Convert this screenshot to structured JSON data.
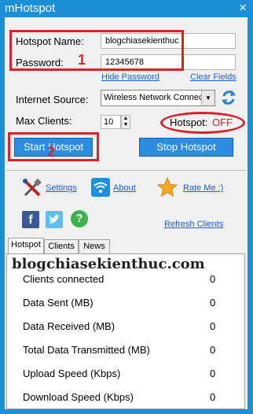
{
  "window": {
    "title": "mHotspot",
    "close_symbol": "×"
  },
  "form": {
    "hotspot_name_label": "Hotspot Name:",
    "hotspot_name_value": "blogchiasekienthuc",
    "password_label": "Password:",
    "password_value": "12345678",
    "hide_password_link": "Hide Password",
    "clear_fields_link": "Clear Fields",
    "internet_source_label": "Internet Source:",
    "internet_source_value": "Wireless Network Connec",
    "max_clients_label": "Max Clients:",
    "max_clients_value": "10",
    "hotspot_status_label": "Hotspot:",
    "hotspot_status_value": "OFF"
  },
  "annotations": {
    "box1_number": "1",
    "box2_number": "2"
  },
  "buttons": {
    "start": "Start Hotspot",
    "stop": "Stop Hotspot"
  },
  "links": {
    "settings": "Settings",
    "about": "About",
    "rate_me": "Rate Me :)",
    "refresh_clients": "Refresh Clients"
  },
  "social": {
    "facebook": "f",
    "help": "?"
  },
  "tabs": [
    {
      "label": "Hotspot",
      "active": true
    },
    {
      "label": "Clients",
      "active": false
    },
    {
      "label": "News",
      "active": false
    }
  ],
  "watermark": "blogchiasekienthuc.com",
  "stats": [
    {
      "label": "Clients connected",
      "value": "0"
    },
    {
      "label": "Data Sent (MB)",
      "value": "0"
    },
    {
      "label": "Data Received (MB)",
      "value": "0"
    },
    {
      "label": "Total Data Transmitted (MB)",
      "value": "0"
    },
    {
      "label": "Upload Speed (Kbps)",
      "value": "0"
    },
    {
      "label": "Download Speed (Kbps)",
      "value": "0"
    }
  ],
  "colors": {
    "accent": "#1c8fd6",
    "status_off": "#d8232a",
    "annotation": "#d8232a"
  },
  "icons": [
    "settings-tools-icon",
    "wifi-icon",
    "star-icon",
    "facebook-icon",
    "twitter-icon",
    "help-icon",
    "refresh-icon"
  ]
}
